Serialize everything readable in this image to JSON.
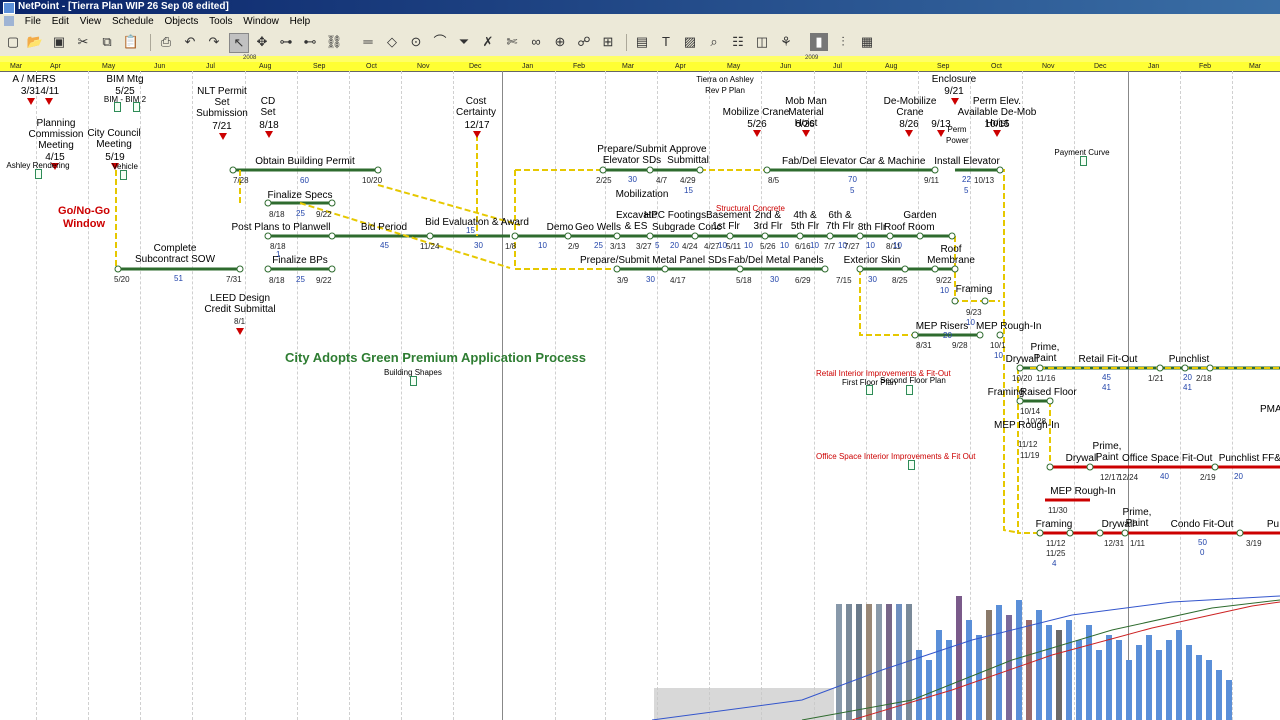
{
  "window": {
    "title": "NetPoint - [Tierra Plan WIP 26 Sep 08 edited]"
  },
  "menu": [
    "File",
    "Edit",
    "View",
    "Schedule",
    "Objects",
    "Tools",
    "Window",
    "Help"
  ],
  "timescale": {
    "years": [
      "2008",
      "2009"
    ],
    "months": [
      "Mar",
      "Apr",
      "May",
      "Jun",
      "Jul",
      "Aug",
      "Sep",
      "Oct",
      "Nov",
      "Dec",
      "Jan",
      "Feb",
      "Mar",
      "Apr",
      "May",
      "Jun",
      "Jul",
      "Aug",
      "Sep",
      "Oct",
      "Nov",
      "Dec",
      "Jan",
      "Feb",
      "Mar"
    ]
  },
  "milestones_top": [
    {
      "text": "A / MERS",
      "date": "3/314/11"
    },
    {
      "text": "BIM Mtg",
      "date": "5/25",
      "sub": "BIM - BIM 2"
    },
    {
      "text": "NLT Permit Set Submission",
      "date": "7/21"
    },
    {
      "text": "CD Set",
      "date": "8/18"
    },
    {
      "text": "Cost Certainty",
      "date": "12/17"
    },
    {
      "text": "Tierra on Ashley Rev P Plan"
    },
    {
      "text": "Mobilize Crane",
      "date": "5/26"
    },
    {
      "text": "Mob Man Material Hoist",
      "date": "6/26"
    },
    {
      "text": "De-Mobilize Crane",
      "date": "8/26"
    },
    {
      "text": "Enclosure",
      "date": "9/21"
    },
    {
      "text": "9/13",
      "sub": "Perm Power"
    },
    {
      "text": "Perm Elev. Available De-Mob Hoist",
      "date": "10/15"
    },
    {
      "text": "Payment Curve"
    }
  ],
  "planning": [
    {
      "text": "Planning Commission Meeting",
      "date": "4/15"
    },
    {
      "text": "City Council Meeting",
      "date": "5/19"
    },
    {
      "text": "Ashley Rendering"
    },
    {
      "text": "Vehicle"
    }
  ],
  "go_no_go": "Go/No-Go Window",
  "city_adopts": "City Adopts Green Premium Application Process",
  "building_shapes": "Building Shapes",
  "structural_concrete": "Structural Concrete",
  "retail_interior": "Retail Interior Improvements & Fit-Out",
  "first_floor_plan": "First Floor Plan",
  "second_floor_plan": "Second Floor Plan",
  "office_interior": "Office Space Interior Improvements & Fit Out",
  "pma": "PMA",
  "activities": {
    "complete_sow": {
      "text": "Complete Subcontract SOW",
      "start": "5/20",
      "end": "7/31",
      "dur": "51"
    },
    "leed": {
      "text": "LEED Design Credit Submittal",
      "date": "8/1"
    },
    "obtain_permit": {
      "text": "Obtain Building Permit",
      "start": "7/28",
      "end": "10/20",
      "dur": "60"
    },
    "finalize_specs": {
      "text": "Finalize Specs",
      "start": "8/18",
      "end": "9/22",
      "dur": "25"
    },
    "post_plans": {
      "text": "Post Plans to Planwell",
      "start": "8/18",
      "dur": "1"
    },
    "finalize_bps": {
      "text": "Finalize BPs",
      "start": "8/18",
      "end": "9/22",
      "dur": "25"
    },
    "bid_period": {
      "text": "Bid Period",
      "end": "11/24",
      "dur": "45"
    },
    "bid_eval": {
      "text": "Bid Evaluation & Award",
      "end": "1/8",
      "dur": "30",
      "dur2": "15"
    },
    "demo": {
      "text": "Demo",
      "start": "2/9",
      "dur": "10"
    },
    "geo_wells": {
      "text": "Geo Wells",
      "start": "3/13",
      "dur": "25"
    },
    "excavate": {
      "text": "Excavate & ES",
      "start": "3/27",
      "dur": "5"
    },
    "mobilization": {
      "text": "Mobilization"
    },
    "hpc_footings": {
      "text": "HPC Footings"
    },
    "subgrade": {
      "text": "Subgrade Conc",
      "start": "4/24",
      "dur": "20"
    },
    "basement": {
      "text": "Basement 1st Flr",
      "start": "4/27",
      "dur": "10"
    },
    "lvl2": {
      "text": "2nd & 3rd Flr",
      "start": "5/11",
      "dur": "10"
    },
    "lvl4": {
      "text": "4th & 5th Flr",
      "start": "5/26",
      "dur": "10"
    },
    "lvl6": {
      "text": "6th & 7th Flr",
      "start": "6/16",
      "dur": "10"
    },
    "lvl8": {
      "text": "8th Flr",
      "start": "7/7",
      "dur": "10"
    },
    "roof_room": {
      "text": "Roof Room",
      "start": "7/27",
      "dur": "10"
    },
    "garden": {
      "text": "Garden",
      "start": "8/11",
      "dur": "10"
    },
    "elev_sds": {
      "text": "Prepare/Submit Elevator SDs",
      "start": "2/25",
      "dur": "30"
    },
    "approve_sub": {
      "text": "Approve Submittal",
      "start": "4/7",
      "end": "4/29",
      "dur": "15"
    },
    "fab_elev": {
      "text": "Fab/Del Elevator Car & Machine",
      "start": "8/5",
      "dur": "70",
      "dur2": "5"
    },
    "install_elev": {
      "text": "Install Elevator",
      "start": "9/11",
      "end": "10/13",
      "dur": "22",
      "dur2": "5"
    },
    "metal_sds": {
      "text": "Prepare/Submit Metal Panel SDs",
      "start": "3/9",
      "end": "4/17",
      "dur": "30"
    },
    "fab_metal": {
      "text": "Fab/Del Metal Panels",
      "start": "5/18",
      "end": "6/29",
      "dur": "30"
    },
    "ext_skin": {
      "text": "Exterior Skin",
      "start": "7/15",
      "end": "8/25",
      "dur": "30"
    },
    "roof_membrane": {
      "text": "Roof Membrane",
      "start": "9/22",
      "dur": "10"
    },
    "framing1": {
      "text": "Framing",
      "start": "9/23",
      "dur": "10"
    },
    "mep_risers": {
      "text": "MEP Risers",
      "start": "8/31",
      "end": "9/28",
      "dur": "20"
    },
    "mep_rough": {
      "text": "MEP Rough-In",
      "start": "10/1",
      "dur": "10"
    },
    "drywall1": {
      "text": "Drywall",
      "start": "10/20"
    },
    "prime_paint1": {
      "text": "Prime, Paint",
      "start": "11/16"
    },
    "retail_fitout": {
      "text": "Retail Fit-Out",
      "dur": "45",
      "dur2": "41"
    },
    "punchlist1": {
      "text": "Punchlist",
      "start": "1/21",
      "end": "2/18",
      "dur": "20",
      "dur2": "41"
    },
    "framing2": {
      "text": "Framing",
      "start": "10/14",
      "end": "10/28"
    },
    "raised_floor": {
      "text": "Raised Floor"
    },
    "mep_rough2": {
      "text": "MEP Rough-In",
      "start": "11/12",
      "end": "11/19"
    },
    "drywall2": {
      "text": "Drywall",
      "start": "12/17"
    },
    "prime_paint2": {
      "text": "Prime, Paint",
      "start": "12/24"
    },
    "office_fitout": {
      "text": "Office Space Fit-Out",
      "dur": "40"
    },
    "punchlist2": {
      "text": "Punchlist",
      "start": "2/19",
      "dur": "20"
    },
    "ffe": {
      "text": "FF&"
    },
    "mep_rough3": {
      "text": "MEP Rough-In",
      "start": "11/30"
    },
    "framing3": {
      "text": "Framing",
      "start": "11/12",
      "end": "11/25",
      "dur": "4"
    },
    "drywall3": {
      "text": "Drywall",
      "start": "12/31"
    },
    "prime_paint3": {
      "text": "Prime, Paint",
      "start": "1/11"
    },
    "condo_fitout": {
      "text": "Condo Fit-Out",
      "dur": "50",
      "dur2": "0"
    },
    "pu": {
      "text": "Pu",
      "start": "3/19"
    }
  },
  "colors": {
    "critical": "#cc0000",
    "normal": "#2e6b2e",
    "link": "#e6c800",
    "timeline": "#ffff33"
  }
}
